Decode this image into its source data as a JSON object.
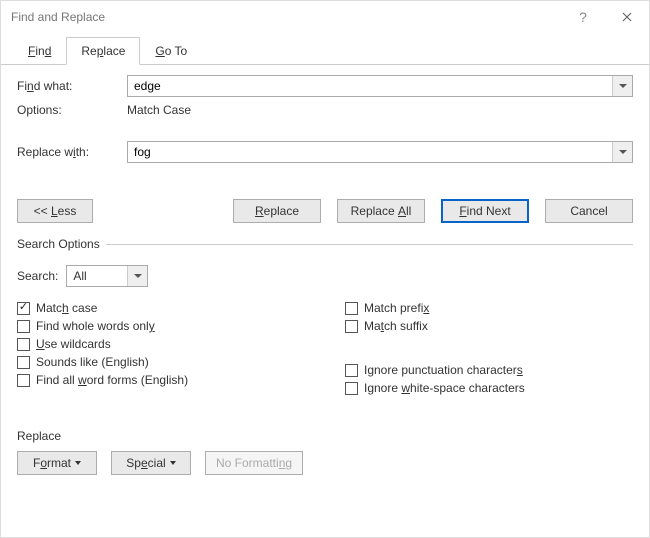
{
  "window": {
    "title": "Find and Replace"
  },
  "tabs": {
    "find": "Find",
    "replace": "Replace",
    "goto": "Go To",
    "active": "replace"
  },
  "find": {
    "label": "Find what:",
    "value": "edge"
  },
  "options_line": {
    "label": "Options:",
    "value": "Match Case"
  },
  "replace": {
    "label": "Replace with:",
    "value": "fog"
  },
  "buttons": {
    "less": "<<  Less",
    "replace": "Replace",
    "replace_all": "Replace All",
    "find_next": "Find Next",
    "cancel": "Cancel"
  },
  "search_options": {
    "legend": "Search Options",
    "search_label": "Search:",
    "search_value": "All",
    "match_case": "Match case",
    "whole_words": "Find whole words only",
    "wildcards": "Use wildcards",
    "sounds_like": "Sounds like (English)",
    "word_forms": "Find all word forms (English)",
    "match_prefix": "Match prefix",
    "match_suffix": "Match suffix",
    "ignore_punct": "Ignore punctuation characters",
    "ignore_ws": "Ignore white-space characters",
    "checked": {
      "match_case": true
    }
  },
  "replace_section": {
    "heading": "Replace",
    "format": "Format",
    "special": "Special",
    "no_formatting": "No Formatting"
  }
}
